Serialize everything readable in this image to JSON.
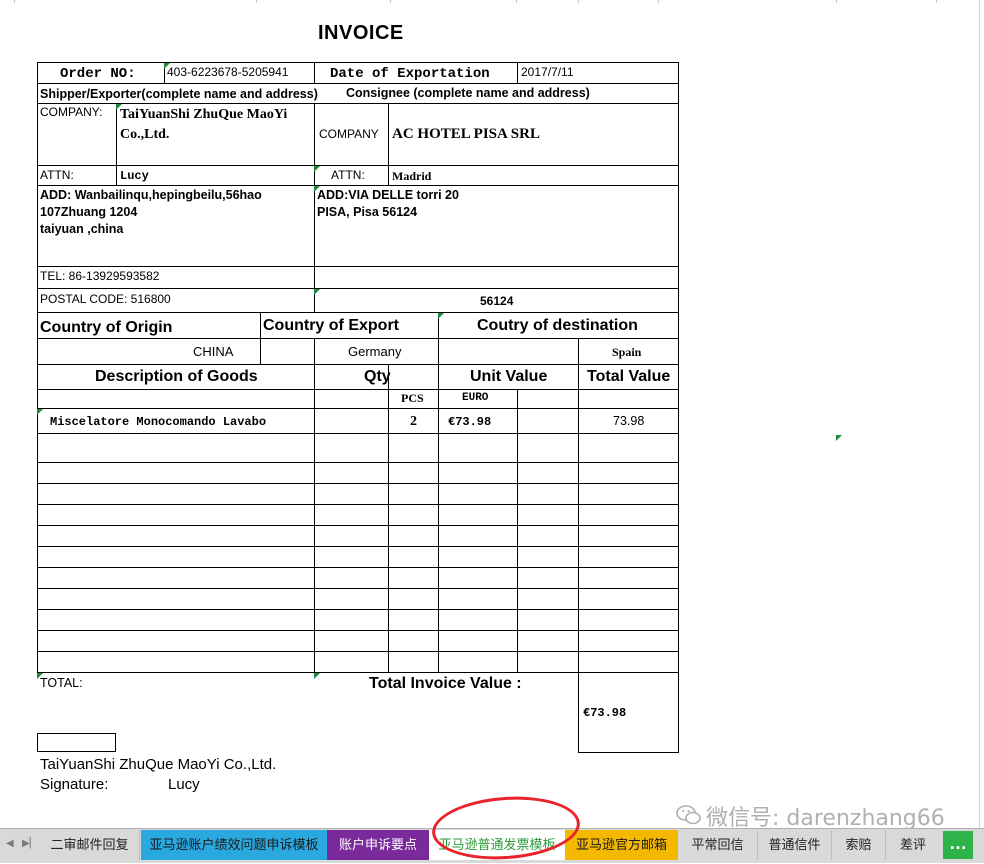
{
  "invoice": {
    "title": "INVOICE",
    "order_no_label": "Order NO:",
    "order_no": "403-6223678-5205941",
    "date_label": "Date of Exportation",
    "date": "2017/7/11",
    "shipper_label": "Shipper/Exporter(complete name and address)",
    "consignee_label": "Consignee (complete name and address)",
    "company_label_left": "COMPANY:",
    "company_left_line1": "TaiYuanShi ZhuQue MaoYi",
    "company_left_line2": "Co.,Ltd.",
    "company_label_right": "COMPANY",
    "company_right": "AC HOTEL PISA SRL",
    "attn_label": "ATTN:",
    "attn_left": "Lucy",
    "attn_label_right": "ATTN:",
    "attn_right": "Madrid",
    "addr_left_1": "ADD:  Wanbailinqu,hepingbeilu,56hao",
    "addr_left_2": "107Zhuang 1204",
    "addr_left_3": "taiyuan ,china",
    "addr_right_1": "ADD:VIA DELLE torri 20",
    "addr_right_2": "PISA, Pisa 56124",
    "tel": "TEL: 86-13929593582",
    "postal": "POSTAL CODE: 516800",
    "postal_right": "56124",
    "origin_label": "Country of Origin",
    "export_label": "Country of Export",
    "dest_label": "Coutry of destination",
    "origin": "CHINA",
    "export": "Germany",
    "dest": "Spain",
    "desc_label": "Description of Goods",
    "qty_label": "Qty",
    "unit_label": "Unit Value",
    "total_label": "Total Value",
    "qty_unit": "PCS",
    "currency": "EURO",
    "item_desc": "Miscelatore Monocomando Lavabo",
    "item_qty": "2",
    "item_unit": "€73.98",
    "item_total": "73.98",
    "total_label_left": "TOTAL:",
    "total_invoice_label": "Total Invoice Value :",
    "total_invoice": "€73.98",
    "signer_company": "TaiYuanShi ZhuQue MaoYi Co.,Ltd.",
    "signature_label": "Signature:",
    "signature_name": "Lucy"
  },
  "sheet_tabs": [
    {
      "label": "二审邮件回复",
      "color": "#d9d9d9",
      "text": "#222222"
    },
    {
      "label": "亚马逊账户绩效问题申诉模板",
      "color": "#2aa8e0",
      "text": "#1a1a1a"
    },
    {
      "label": "账户申诉要点",
      "color": "#7a2a9a",
      "text": "#ffffff"
    },
    {
      "label": "亚马逊普通发票模板",
      "color": "#ffffff",
      "text": "#2e9a3a"
    },
    {
      "label": "亚马逊官方邮箱",
      "color": "#f5b800",
      "text": "#1a1a1a"
    },
    {
      "label": "平常回信",
      "color": "#d9d9d9",
      "text": "#222222"
    },
    {
      "label": "普通信件",
      "color": "#d9d9d9",
      "text": "#222222"
    },
    {
      "label": "索赔",
      "color": "#d9d9d9",
      "text": "#222222"
    },
    {
      "label": "差评",
      "color": "#d9d9d9",
      "text": "#222222"
    }
  ],
  "more_tabs": "…",
  "watermark": "微信号: darenzhang66",
  "colors": {
    "grid": "#000000",
    "accent_green": "#1f8a3a",
    "highlight_circle": "#e8242a"
  }
}
